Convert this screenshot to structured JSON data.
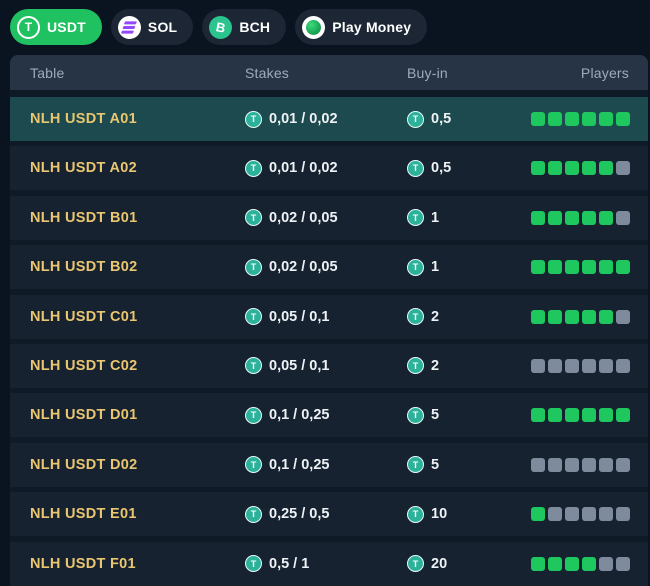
{
  "icons": {
    "tether_letter": "T"
  },
  "colors": {
    "accent_green": "#1fc161",
    "square_green": "#1fc75f",
    "square_gray": "#7e8b9d",
    "table_name_gold": "#e9c66f",
    "selected_row_teal": "#1d4a4e",
    "tether_teal": "#2cb29b",
    "solana_purple": "#9447ff",
    "bch_green": "#2bc48e"
  },
  "tabs": [
    {
      "label": "USDT",
      "icon": "tether-icon",
      "icon_letter": "T",
      "active": true
    },
    {
      "label": "SOL",
      "icon": "solana-icon",
      "icon_letter": "",
      "active": false
    },
    {
      "label": "BCH",
      "icon": "bch-icon",
      "icon_letter": "B",
      "active": false
    },
    {
      "label": "Play Money",
      "icon": "play-money-icon",
      "icon_letter": "",
      "active": false
    }
  ],
  "table": {
    "headers": {
      "table": "Table",
      "stakes": "Stakes",
      "buyin": "Buy-in",
      "players": "Players"
    },
    "max_players": 6,
    "rows": [
      {
        "name": "NLH USDT A01",
        "stakes": "0,01 / 0,02",
        "buyin": "0,5",
        "players": 6,
        "selected": true
      },
      {
        "name": "NLH USDT A02",
        "stakes": "0,01 / 0,02",
        "buyin": "0,5",
        "players": 5,
        "selected": false
      },
      {
        "name": "NLH USDT B01",
        "stakes": "0,02 / 0,05",
        "buyin": "1",
        "players": 5,
        "selected": false
      },
      {
        "name": "NLH USDT B02",
        "stakes": "0,02 / 0,05",
        "buyin": "1",
        "players": 6,
        "selected": false
      },
      {
        "name": "NLH USDT C01",
        "stakes": "0,05 / 0,1",
        "buyin": "2",
        "players": 5,
        "selected": false
      },
      {
        "name": "NLH USDT C02",
        "stakes": "0,05 / 0,1",
        "buyin": "2",
        "players": 0,
        "selected": false
      },
      {
        "name": "NLH USDT D01",
        "stakes": "0,1 / 0,25",
        "buyin": "5",
        "players": 6,
        "selected": false
      },
      {
        "name": "NLH USDT D02",
        "stakes": "0,1 / 0,25",
        "buyin": "5",
        "players": 0,
        "selected": false
      },
      {
        "name": "NLH USDT E01",
        "stakes": "0,25 / 0,5",
        "buyin": "10",
        "players": 1,
        "selected": false
      },
      {
        "name": "NLH USDT F01",
        "stakes": "0,5 / 1",
        "buyin": "20",
        "players": 4,
        "selected": false
      }
    ]
  }
}
